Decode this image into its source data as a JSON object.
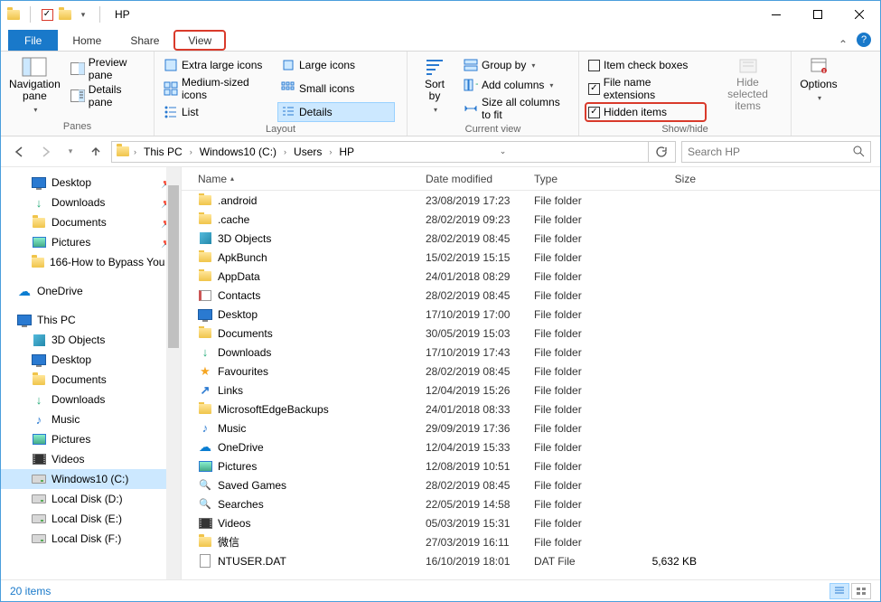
{
  "window": {
    "title": "HP"
  },
  "tabs": {
    "file": "File",
    "home": "Home",
    "share": "Share",
    "view": "View"
  },
  "ribbon": {
    "panes": {
      "nav": "Navigation\npane",
      "preview": "Preview pane",
      "details": "Details pane",
      "label": "Panes"
    },
    "layout": {
      "xl": "Extra large icons",
      "l": "Large icons",
      "m": "Medium-sized icons",
      "s": "Small icons",
      "list": "List",
      "details": "Details",
      "label": "Layout"
    },
    "current": {
      "sort": "Sort\nby",
      "group": "Group by",
      "addcols": "Add columns",
      "sizeall": "Size all columns to fit",
      "label": "Current view"
    },
    "showhide": {
      "itemcheck": "Item check boxes",
      "ext": "File name extensions",
      "hidden": "Hidden items",
      "hidesel": "Hide selected\nitems",
      "label": "Show/hide"
    },
    "options": "Options"
  },
  "breadcrumb": [
    "This PC",
    "Windows10 (C:)",
    "Users",
    "HP"
  ],
  "search": {
    "placeholder": "Search HP"
  },
  "tree": {
    "quick": [
      {
        "label": "Desktop",
        "icon": "monitor",
        "pin": true
      },
      {
        "label": "Downloads",
        "icon": "dl",
        "pin": true
      },
      {
        "label": "Documents",
        "icon": "folder",
        "pin": true
      },
      {
        "label": "Pictures",
        "icon": "pic",
        "pin": true
      },
      {
        "label": "166-How to Bypass You",
        "icon": "folder",
        "pin": true
      }
    ],
    "onedrive": "OneDrive",
    "thispc": "This PC",
    "pcitems": [
      {
        "label": "3D Objects",
        "icon": "cube"
      },
      {
        "label": "Desktop",
        "icon": "monitor"
      },
      {
        "label": "Documents",
        "icon": "folder"
      },
      {
        "label": "Downloads",
        "icon": "dl"
      },
      {
        "label": "Music",
        "icon": "music"
      },
      {
        "label": "Pictures",
        "icon": "pic"
      },
      {
        "label": "Videos",
        "icon": "vid"
      },
      {
        "label": "Windows10 (C:)",
        "icon": "drive",
        "sel": true
      },
      {
        "label": "Local Disk (D:)",
        "icon": "drive"
      },
      {
        "label": "Local Disk (E:)",
        "icon": "drive"
      },
      {
        "label": "Local Disk (F:)",
        "icon": "drive"
      }
    ]
  },
  "cols": {
    "name": "Name",
    "date": "Date modified",
    "type": "Type",
    "size": "Size"
  },
  "rows": [
    {
      "name": ".android",
      "date": "23/08/2019 17:23",
      "type": "File folder",
      "icon": "folder"
    },
    {
      "name": ".cache",
      "date": "28/02/2019 09:23",
      "type": "File folder",
      "icon": "folder"
    },
    {
      "name": "3D Objects",
      "date": "28/02/2019 08:45",
      "type": "File folder",
      "icon": "cube"
    },
    {
      "name": "ApkBunch",
      "date": "15/02/2019 15:15",
      "type": "File folder",
      "icon": "folder"
    },
    {
      "name": "AppData",
      "date": "24/01/2018 08:29",
      "type": "File folder",
      "icon": "folder"
    },
    {
      "name": "Contacts",
      "date": "28/02/2019 08:45",
      "type": "File folder",
      "icon": "contact"
    },
    {
      "name": "Desktop",
      "date": "17/10/2019 17:00",
      "type": "File folder",
      "icon": "monitor"
    },
    {
      "name": "Documents",
      "date": "30/05/2019 15:03",
      "type": "File folder",
      "icon": "folder"
    },
    {
      "name": "Downloads",
      "date": "17/10/2019 17:43",
      "type": "File folder",
      "icon": "dl"
    },
    {
      "name": "Favourites",
      "date": "28/02/2019 08:45",
      "type": "File folder",
      "icon": "star"
    },
    {
      "name": "Links",
      "date": "12/04/2019 15:26",
      "type": "File folder",
      "icon": "link"
    },
    {
      "name": "MicrosoftEdgeBackups",
      "date": "24/01/2018 08:33",
      "type": "File folder",
      "icon": "folder"
    },
    {
      "name": "Music",
      "date": "29/09/2019 17:36",
      "type": "File folder",
      "icon": "music"
    },
    {
      "name": "OneDrive",
      "date": "12/04/2019 15:33",
      "type": "File folder",
      "icon": "cloud"
    },
    {
      "name": "Pictures",
      "date": "12/08/2019 10:51",
      "type": "File folder",
      "icon": "pic"
    },
    {
      "name": "Saved Games",
      "date": "28/02/2019 08:45",
      "type": "File folder",
      "icon": "search"
    },
    {
      "name": "Searches",
      "date": "22/05/2019 14:58",
      "type": "File folder",
      "icon": "search"
    },
    {
      "name": "Videos",
      "date": "05/03/2019 15:31",
      "type": "File folder",
      "icon": "vid"
    },
    {
      "name": "微信",
      "date": "27/03/2019 16:11",
      "type": "File folder",
      "icon": "folder"
    },
    {
      "name": "NTUSER.DAT",
      "date": "16/10/2019 18:01",
      "type": "DAT File",
      "size": "5,632 KB",
      "icon": "file"
    }
  ],
  "status": {
    "count": "20 items"
  }
}
